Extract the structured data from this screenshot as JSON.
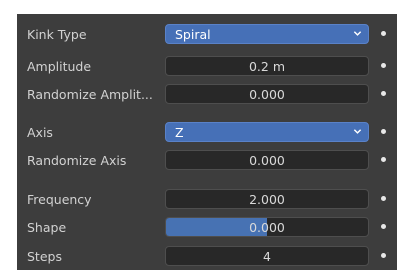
{
  "properties": [
    {
      "label": "Kink Type",
      "type": "dropdown",
      "value": "Spiral"
    },
    {
      "label": "Amplitude",
      "type": "number",
      "value": "0.2 m"
    },
    {
      "label": "Randomize Amplit...",
      "type": "number",
      "value": "0.000"
    },
    {
      "label": "Axis",
      "type": "dropdown",
      "value": "Z"
    },
    {
      "label": "Randomize Axis",
      "type": "number",
      "value": "0.000"
    },
    {
      "label": "Frequency",
      "type": "number",
      "value": "2.000"
    },
    {
      "label": "Shape",
      "type": "slider",
      "value": "0.000",
      "fill_fraction": 0.5
    },
    {
      "label": "Steps",
      "type": "number",
      "value": "4"
    }
  ],
  "icons": {
    "dropdown_chevron": "chevron-down-icon",
    "keyframe": "keyframe-dot-icon"
  },
  "colors": {
    "panel_bg": "#3d3d3d",
    "field_bg": "#282828",
    "accent": "#4772b3"
  }
}
